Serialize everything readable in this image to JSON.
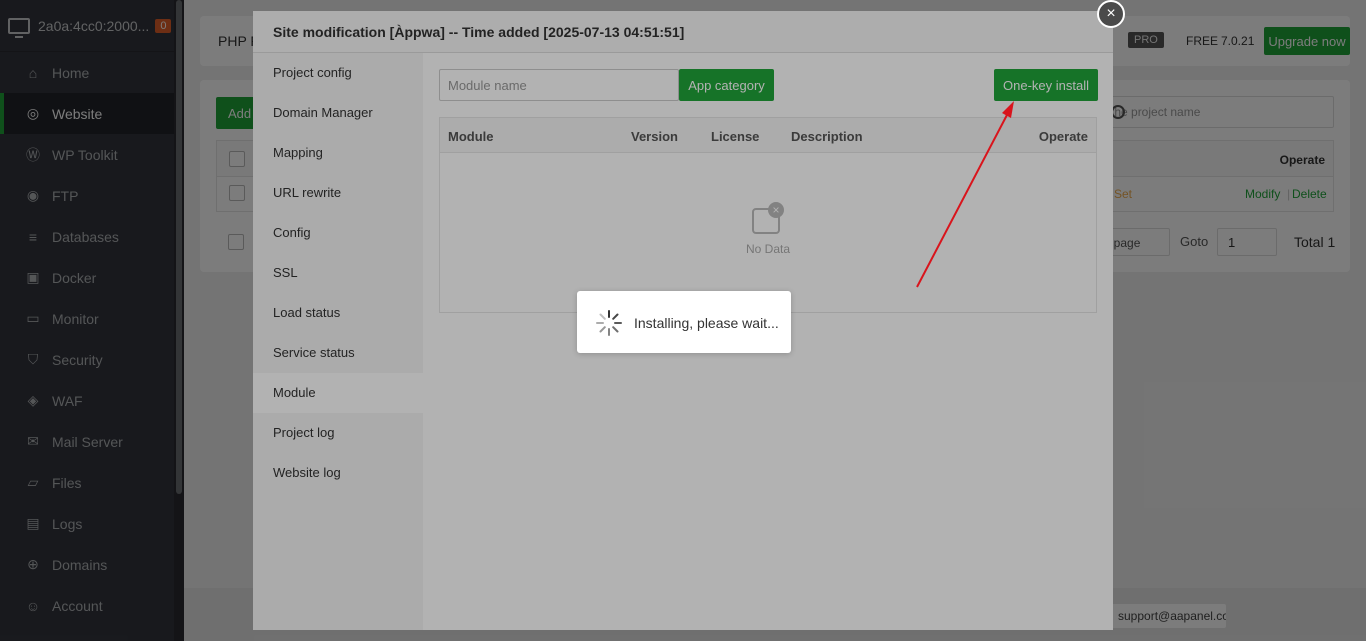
{
  "sidebar": {
    "server": "2a0a:4cc0:2000...",
    "badge": "0",
    "items": [
      {
        "label": "Home",
        "icon": "home-icon"
      },
      {
        "label": "Website",
        "icon": "globe-icon"
      },
      {
        "label": "WP Toolkit",
        "icon": "wordpress-icon"
      },
      {
        "label": "FTP",
        "icon": "ftp-icon"
      },
      {
        "label": "Databases",
        "icon": "database-icon"
      },
      {
        "label": "Docker",
        "icon": "docker-icon"
      },
      {
        "label": "Monitor",
        "icon": "monitor-icon"
      },
      {
        "label": "Security",
        "icon": "shield-icon"
      },
      {
        "label": "WAF",
        "icon": "waf-icon"
      },
      {
        "label": "Mail Server",
        "icon": "mail-icon"
      },
      {
        "label": "Files",
        "icon": "folder-icon"
      },
      {
        "label": "Logs",
        "icon": "logs-icon"
      },
      {
        "label": "Domains",
        "icon": "domains-icon"
      },
      {
        "label": "Account",
        "icon": "user-icon"
      }
    ]
  },
  "topbar": {
    "php": "PHP P",
    "pro": "PRO",
    "free": "FREE",
    "version": "7.0.21",
    "upgrade": "Upgrade now"
  },
  "panel": {
    "add": "Add",
    "search_placeholder": "the project name",
    "operate_header": "Operate",
    "set": "Set",
    "modify": "Modify",
    "sep": "|",
    "delete": "Delete",
    "per_page": "/ page",
    "goto": "Goto",
    "goto_value": "1",
    "total": "Total 1"
  },
  "footer": {
    "email": "support@aapanel.com"
  },
  "modal": {
    "title": "Site modification [Àppwa] -- Time added [2025-07-13 04:51:51]",
    "close": "×",
    "menu": [
      "Project config",
      "Domain Manager",
      "Mapping",
      "URL rewrite",
      "Config",
      "SSL",
      "Load status",
      "Service status",
      "Module",
      "Project log",
      "Website log"
    ],
    "active_menu": "Module",
    "module_placeholder": "Module name",
    "app_category": "App category",
    "one_key_install": "One-key install",
    "columns": [
      "Module",
      "Version",
      "License",
      "Description",
      "Operate"
    ],
    "no_data": "No Data"
  },
  "loading": {
    "message": "Installing, please wait..."
  },
  "colors": {
    "accent": "#20a53a",
    "sidebar": "#33363d",
    "arrow": "#d9141c"
  }
}
